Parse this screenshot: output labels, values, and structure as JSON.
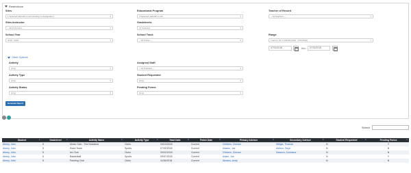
{
  "restrictions": {
    "title": "Restrictions"
  },
  "filters": {
    "sites": {
      "label": "Sites",
      "value": "1 Selected (defaults to all including no designation)"
    },
    "educational_program": {
      "label": "Educational Program",
      "value": "0 Selected (defaults to all)"
    },
    "teacher_of_record": {
      "label": "Teacher of Record",
      "value": "-- All Teachers --"
    },
    "sites_instructor": {
      "label": "Sites Instructor",
      "value": "-- All Instructors --"
    },
    "gradelevels": {
      "label": "Gradelevels",
      "value": "14 Selected"
    },
    "school_year": {
      "label": "School Year",
      "value": "2018 - 2019"
    },
    "school_track": {
      "label": "School Track",
      "value": "-- All Tracks --"
    },
    "range": {
      "label": "Range",
      "value": "Track A: 1/F 7/1/2018 (2019 - 07/1/2019)"
    },
    "range_start": "07/01/2018",
    "range_end_prefix": "thru",
    "range_end": "07/31/2019"
  },
  "other_options": {
    "title": "Other Options",
    "activity": {
      "label": "Activity",
      "value": "(Any)"
    },
    "assigned_staff": {
      "label": "Assigned Staff",
      "value": "-- All Teachers --"
    },
    "activity_type": {
      "label": "Activity Type",
      "value": "(Any)"
    },
    "student_requested": {
      "label": "Student Requested",
      "value": "(Any)"
    },
    "activity_status": {
      "label": "Activity Status",
      "value": "(Any)"
    },
    "pending_forms": {
      "label": "Pending Forms",
      "value": "(Any)"
    }
  },
  "generate_button": "Generate Report",
  "search": {
    "label": "Search"
  },
  "table": {
    "headers": [
      "Student",
      "Gradelevel",
      "Activity Name",
      "Activity Type",
      "Start Date",
      "Finish Date",
      "Primary Advisor",
      "Secondary Advisor",
      "Student Requested",
      "Pending Forms"
    ],
    "rows": [
      [
        "Abney, John",
        "5",
        "Music Club - The Notations",
        "Clubs",
        "04/10/2018",
        "Current",
        "Childers, Chesse",
        "Hilliger, Thomas",
        "N",
        "Y"
      ],
      [
        "Abney, John",
        "5",
        "Swim Team",
        "Sports",
        "07/02/2018",
        "Current",
        "Adams, Joe",
        "Ashton, Taryn",
        "N",
        "N"
      ],
      [
        "Abney, John",
        "5",
        "Art Club",
        "Clubs",
        "09/02/2018",
        "Current",
        "Childers, Chesse",
        "Dawson, Constanz",
        "N",
        "N"
      ],
      [
        "Abney, John",
        "5",
        "Basketball",
        "Sports",
        "09/07/2018",
        "Current",
        "Adam, Joe",
        "",
        "N",
        "Y"
      ],
      [
        "Abney, John",
        "5",
        "Painting Club",
        "Clubs",
        "11/06/2018",
        "Current",
        "Abrams, Andy",
        "",
        "N",
        "N"
      ]
    ]
  },
  "colors": {
    "accent": "#2c6fb1",
    "header_bg": "#2b2f36",
    "link": "#2d66b0",
    "row_alt": "#eef1f6"
  }
}
